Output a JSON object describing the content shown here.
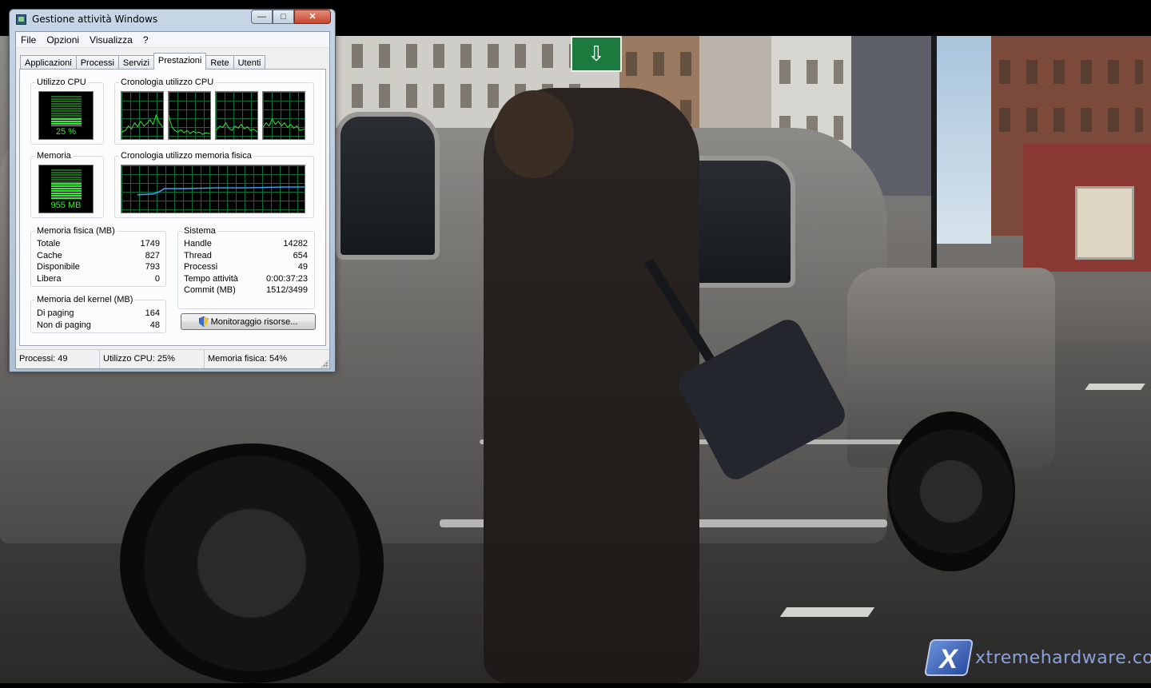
{
  "window": {
    "title": "Gestione attività Windows",
    "caption_buttons": {
      "minimize": "—",
      "maximize": "□",
      "close": "✕"
    }
  },
  "menu": [
    "File",
    "Opzioni",
    "Visualizza",
    "?"
  ],
  "tabs": [
    {
      "label": "Applicazioni",
      "active": false
    },
    {
      "label": "Processi",
      "active": false
    },
    {
      "label": "Servizi",
      "active": false
    },
    {
      "label": "Prestazioni",
      "active": true
    },
    {
      "label": "Rete",
      "active": false
    },
    {
      "label": "Utenti",
      "active": false
    }
  ],
  "performance": {
    "cpu_usage": {
      "label": "Utilizzo CPU",
      "value": "25 %",
      "fraction": 0.25
    },
    "cpu_history": {
      "label": "Cronologia utilizzo CPU",
      "cores": 4
    },
    "memory": {
      "label": "Memoria",
      "value": "955 MB",
      "fraction": 0.54
    },
    "memory_history": {
      "label": "Cronologia utilizzo memoria fisica",
      "level_fraction": 0.54
    },
    "physical_memory": {
      "label": "Memoria fisica (MB)",
      "rows": [
        {
          "name": "Totale",
          "value": "1749"
        },
        {
          "name": "Cache",
          "value": "827"
        },
        {
          "name": "Disponibile",
          "value": "793"
        },
        {
          "name": "Libera",
          "value": "0"
        }
      ]
    },
    "kernel_memory": {
      "label": "Memoria del kernel (MB)",
      "rows": [
        {
          "name": "Di paging",
          "value": "164"
        },
        {
          "name": "Non di paging",
          "value": "48"
        }
      ]
    },
    "system": {
      "label": "Sistema",
      "rows": [
        {
          "name": "Handle",
          "value": "14282"
        },
        {
          "name": "Thread",
          "value": "654"
        },
        {
          "name": "Processi",
          "value": "49"
        },
        {
          "name": "Tempo attività",
          "value": "0:00:37:23"
        },
        {
          "name": "Commit (MB)",
          "value": "1512/3499"
        }
      ]
    },
    "resource_monitor_button": "Monitoraggio risorse..."
  },
  "statusbar": {
    "processes": "Processi: 49",
    "cpu": "Utilizzo CPU: 25%",
    "memory": "Memoria fisica: 54%"
  },
  "watermark": {
    "icon": "X",
    "text": "xtremehardware.com"
  },
  "colors": {
    "meter_green": "#35ea35",
    "grid_green": "#0b6d3a",
    "memory_line": "#3aa6ff"
  }
}
